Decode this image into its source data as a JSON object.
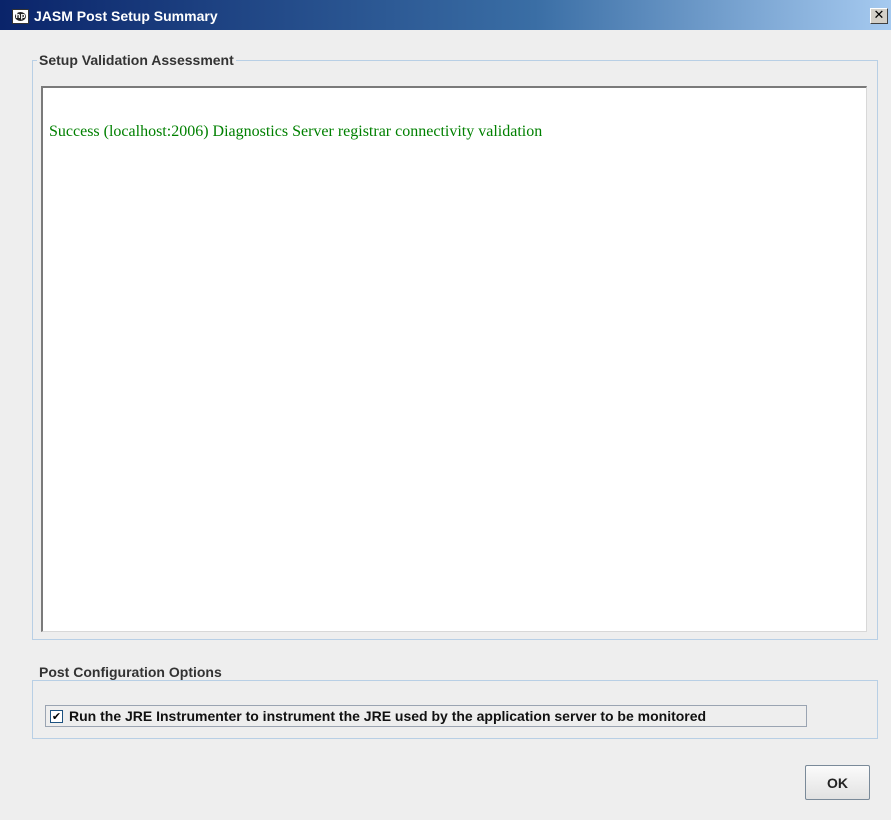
{
  "window": {
    "title": "JASM Post Setup Summary",
    "close_glyph": "✕",
    "icon": "hp-logo-icon"
  },
  "validation": {
    "group_title": "Setup Validation Assessment",
    "results": [
      {
        "text": "Success (localhost:2006) Diagnostics Server registrar connectivity validation",
        "status": "success",
        "color": "#008000"
      }
    ]
  },
  "options": {
    "group_title": "Post Configuration Options",
    "instrument_jre": {
      "label": "Run the JRE Instrumenter to instrument the JRE used by the application server to be monitored",
      "checked": true,
      "check_glyph": "✔"
    }
  },
  "footer": {
    "ok_label": "OK"
  },
  "colors": {
    "title_bar_start": "#0a246a",
    "title_bar_end": "#a6caf0",
    "dialog_background": "#eeeeee",
    "group_border": "#b8cfe5"
  }
}
